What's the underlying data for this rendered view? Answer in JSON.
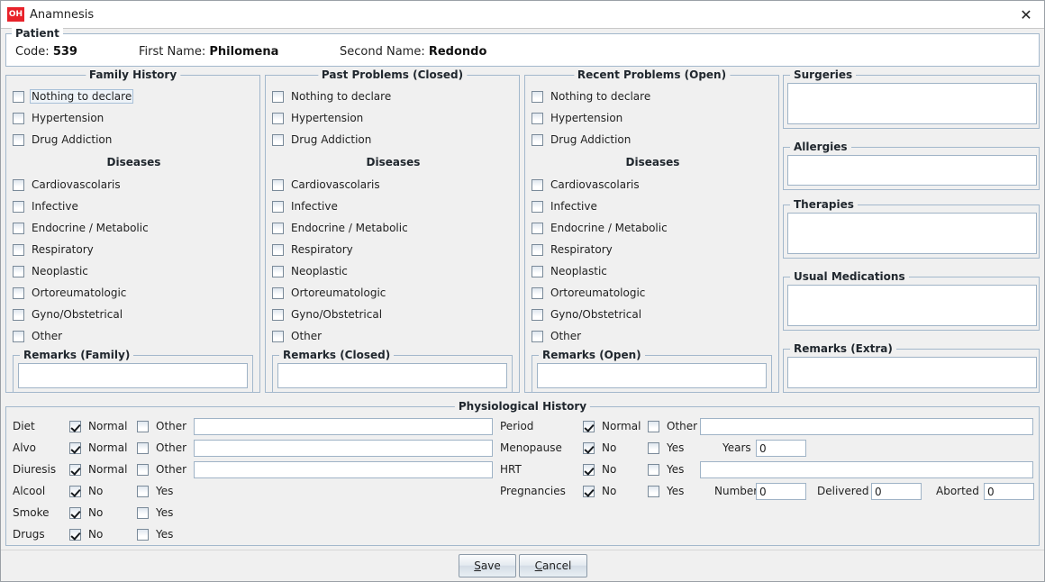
{
  "window": {
    "logo_text": "OH",
    "title": "Anamnesis",
    "close_icon": "✕"
  },
  "patient": {
    "legend": "Patient",
    "code_label": "Code:",
    "code_value": "539",
    "first_name_label": "First Name:",
    "first_name_value": "Philomena",
    "second_name_label": "Second Name:",
    "second_name_value": "Redondo"
  },
  "columns": [
    {
      "legend": "Family History",
      "top_items": [
        "Nothing to declare",
        "Hypertension",
        "Drug Addiction"
      ],
      "diseases_heading": "Diseases",
      "diseases": [
        "Cardiovascolaris",
        "Infective",
        "Endocrine / Metabolic",
        "Respiratory",
        "Neoplastic",
        "Ortoreumatologic",
        "Gyno/Obstetrical",
        "Other"
      ],
      "remarks_legend": "Remarks (Family)",
      "remarks_value": ""
    },
    {
      "legend": "Past Problems (Closed)",
      "top_items": [
        "Nothing to declare",
        "Hypertension",
        "Drug Addiction"
      ],
      "diseases_heading": "Diseases",
      "diseases": [
        "Cardiovascolaris",
        "Infective",
        "Endocrine / Metabolic",
        "Respiratory",
        "Neoplastic",
        "Ortoreumatologic",
        "Gyno/Obstetrical",
        "Other"
      ],
      "remarks_legend": "Remarks (Closed)",
      "remarks_value": ""
    },
    {
      "legend": "Recent Problems (Open)",
      "top_items": [
        "Nothing to declare",
        "Hypertension",
        "Drug Addiction"
      ],
      "diseases_heading": "Diseases",
      "diseases": [
        "Cardiovascolaris",
        "Infective",
        "Endocrine / Metabolic",
        "Respiratory",
        "Neoplastic",
        "Ortoreumatologic",
        "Gyno/Obstetrical",
        "Other"
      ],
      "remarks_legend": "Remarks (Open)",
      "remarks_value": ""
    }
  ],
  "right_panels": [
    {
      "legend": "Surgeries",
      "value": ""
    },
    {
      "legend": "Allergies",
      "value": ""
    },
    {
      "legend": "Therapies",
      "value": ""
    },
    {
      "legend": "Usual Medications",
      "value": ""
    },
    {
      "legend": "Remarks (Extra)",
      "value": ""
    }
  ],
  "physiological": {
    "legend": "Physiological History",
    "left_rows": [
      {
        "label": "Diet",
        "opt1": "Normal",
        "opt1_checked": true,
        "opt2": "Other",
        "opt2_checked": false,
        "text_value": ""
      },
      {
        "label": "Alvo",
        "opt1": "Normal",
        "opt1_checked": true,
        "opt2": "Other",
        "opt2_checked": false,
        "text_value": ""
      },
      {
        "label": "Diuresis",
        "opt1": "Normal",
        "opt1_checked": true,
        "opt2": "Other",
        "opt2_checked": false,
        "text_value": ""
      },
      {
        "label": "Alcool",
        "opt1": "No",
        "opt1_checked": true,
        "opt2": "Yes",
        "opt2_checked": false
      },
      {
        "label": "Smoke",
        "opt1": "No",
        "opt1_checked": true,
        "opt2": "Yes",
        "opt2_checked": false
      },
      {
        "label": "Drugs",
        "opt1": "No",
        "opt1_checked": true,
        "opt2": "Yes",
        "opt2_checked": false
      }
    ],
    "right_rows": [
      {
        "label": "Period",
        "opt1": "Normal",
        "opt1_checked": true,
        "opt2": "Other",
        "opt2_checked": false
      },
      {
        "label": "Menopause",
        "opt1": "No",
        "opt1_checked": true,
        "opt2": "Yes",
        "opt2_checked": false
      },
      {
        "label": "HRT",
        "opt1": "No",
        "opt1_checked": true,
        "opt2": "Yes",
        "opt2_checked": false
      },
      {
        "label": "Pregnancies",
        "opt1": "No",
        "opt1_checked": true,
        "opt2": "Yes",
        "opt2_checked": false
      }
    ],
    "period_text": "",
    "hrt_text": "",
    "years_label": "Years",
    "years_value": "0",
    "number_label": "Number",
    "number_value": "0",
    "delivered_label": "Delivered",
    "delivered_value": "0",
    "aborted_label": "Aborted",
    "aborted_value": "0"
  },
  "footer": {
    "save_label": "Save",
    "save_mnemonic": "S",
    "save_rest": "ave",
    "cancel_label": "Cancel",
    "cancel_mnemonic": "C",
    "cancel_rest": "ancel"
  },
  "colors": {
    "brand_red": "#e8222a",
    "panel_bg": "#f0f0f0",
    "border": "#a3b8cc"
  }
}
